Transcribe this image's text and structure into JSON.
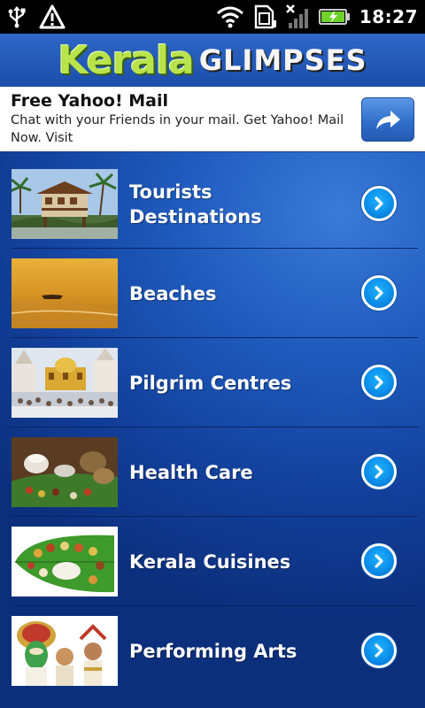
{
  "status_bar": {
    "time": "18:27",
    "icons": [
      "usb-icon",
      "warning-icon",
      "wifi-icon",
      "sim-card-icon",
      "no-signal-icon",
      "battery-charging-icon"
    ]
  },
  "app": {
    "logo_main": "Kerala",
    "logo_sub": "GLIMPSES"
  },
  "ad": {
    "title": "Free Yahoo! Mail",
    "body": "Chat with your Friends in your mail. Get Yahoo! Mail Now. Visit",
    "button_icon": "share-arrow-icon"
  },
  "menu": {
    "items": [
      {
        "label": "Tourists Destinations",
        "thumb": "houseboat-palms-thumbnail"
      },
      {
        "label": "Beaches",
        "thumb": "beach-sunset-thumbnail"
      },
      {
        "label": "Pilgrim Centres",
        "thumb": "temple-church-thumbnail"
      },
      {
        "label": "Health Care",
        "thumb": "ayurveda-thumbnail"
      },
      {
        "label": "Kerala Cuisines",
        "thumb": "banana-leaf-meal-thumbnail"
      },
      {
        "label": "Performing Arts",
        "thumb": "kathakali-thumbnail"
      }
    ]
  },
  "colors": {
    "background": "#1f5bbd",
    "logo_green": "#b9e34a",
    "go_button": "#0a8be8"
  }
}
